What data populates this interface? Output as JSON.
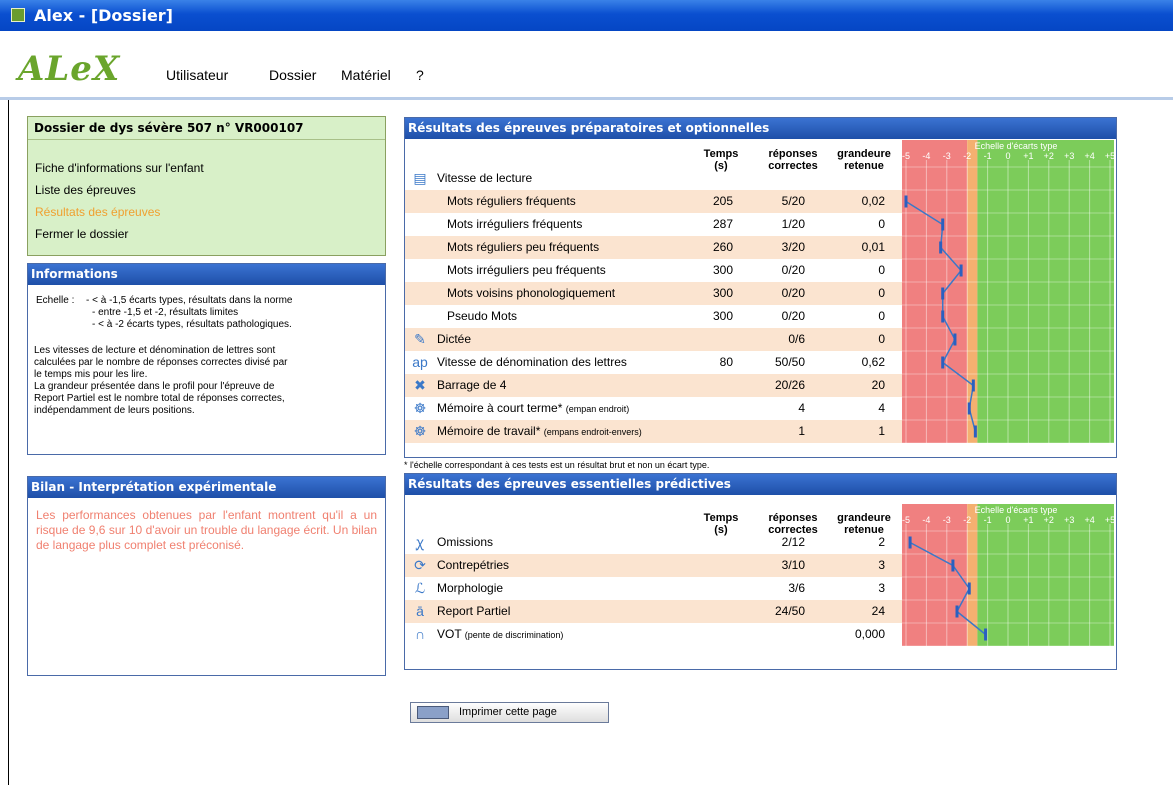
{
  "window": {
    "title": "Alex - [Dossier]"
  },
  "app": {
    "logo": "ALeX"
  },
  "menu": [
    "Utilisateur",
    "Dossier",
    "Matériel",
    "?"
  ],
  "dossier": {
    "title": "Dossier de dys sévère 507 n° VR000107",
    "links": [
      "Fiche d'informations sur l'enfant",
      "Liste des épreuves",
      "Résultats des épreuves",
      "Fermer le dossier"
    ],
    "active_index": 2
  },
  "info": {
    "title": "Informations",
    "scale_label": "Echelle :",
    "scale_lines": [
      "- < à -1,5 écarts types, résultats dans la norme",
      "- entre -1,5 et -2,  résultats limites",
      "- < à -2 écarts types, résultats pathologiques."
    ],
    "text_lines": [
      "Les vitesses de lecture et dénomination de lettres sont",
      "calculées par le nombre de réponses correctes divisé par",
      "le temps mis pour les lire.",
      "La grandeur présentée dans le profil pour l'épreuve de",
      "Report Partiel est le nombre total de réponses correctes,",
      "indépendamment de leurs positions."
    ]
  },
  "bilan": {
    "title": "Bilan - Interprétation expérimentale",
    "text": "Les performances obtenues par l'enfant montrent qu'il a un risque de 9,6 sur 10 d'avoir un trouble du langage écrit. Un bilan de langage plus complet est préconisé."
  },
  "columns": {
    "temps": [
      "Temps",
      "(s)"
    ],
    "reponses": [
      "réponses",
      "correctes"
    ],
    "grandeure": [
      "grandeure",
      "retenue"
    ],
    "scale_title": "Echelle d'écarts type",
    "scale_ticks": [
      "-5",
      "-4",
      "-3",
      "-2",
      "-1",
      "0",
      "+1",
      "+2",
      "+3",
      "+4",
      "+5"
    ]
  },
  "results1": {
    "title": "Résultats des épreuves préparatoires  et optionnelles",
    "rows": [
      {
        "label": "Vitesse de lecture",
        "icon": "book-icon",
        "header": true
      },
      {
        "label": "Mots réguliers fréquents",
        "temps": "205",
        "reponses": "5/20",
        "grandeur": "0,02",
        "indent": true
      },
      {
        "label": "Mots irréguliers fréquents",
        "temps": "287",
        "reponses": "1/20",
        "grandeur": "0",
        "indent": true
      },
      {
        "label": "Mots réguliers peu fréquents",
        "temps": "260",
        "reponses": "3/20",
        "grandeur": "0,01",
        "indent": true
      },
      {
        "label": "Mots irréguliers peu fréquents",
        "temps": "300",
        "reponses": "0/20",
        "grandeur": "0",
        "indent": true
      },
      {
        "label": "Mots voisins phonologiquement",
        "temps": "300",
        "reponses": "0/20",
        "grandeur": "0",
        "indent": true
      },
      {
        "label": "Pseudo Mots",
        "temps": "300",
        "reponses": "0/20",
        "grandeur": "0",
        "indent": true
      },
      {
        "label": "Dictée",
        "icon": "pen-icon",
        "temps": "",
        "reponses": "0/6",
        "grandeur": "0"
      },
      {
        "label": "Vitesse de dénomination des lettres",
        "icon": "letters-icon",
        "temps": "80",
        "reponses": "50/50",
        "grandeur": "0,62"
      },
      {
        "label": "Barrage de 4",
        "icon": "cross-icon",
        "temps": "",
        "reponses": "20/26",
        "grandeur": "20"
      },
      {
        "label": "Mémoire à court terme*",
        "note": "(empan endroit)",
        "icon": "memory-icon",
        "temps": "",
        "reponses": "4",
        "grandeur": "4"
      },
      {
        "label": "Mémoire de travail*",
        "note": "(empans endroit-envers)",
        "icon": "memory-icon",
        "temps": "",
        "reponses": "1",
        "grandeur": "1"
      }
    ],
    "scores": [
      -5,
      -3.2,
      -3.3,
      -2.3,
      -3.2,
      -3.2,
      -2.6,
      -3.2,
      -1.7,
      -1.9,
      -1.6
    ],
    "footnote": "* l'échelle correspondant à ces tests est un résultat brut et non un écart type."
  },
  "results2": {
    "title": "Résultats des épreuves essentielles prédictives",
    "rows": [
      {
        "label": "Omissions",
        "icon": "omission-icon",
        "temps": "",
        "reponses": "2/12",
        "grandeur": "2"
      },
      {
        "label": "Contrepétries",
        "icon": "refresh-icon",
        "temps": "",
        "reponses": "3/10",
        "grandeur": "3"
      },
      {
        "label": "Morphologie",
        "icon": "morpho-icon",
        "temps": "",
        "reponses": "3/6",
        "grandeur": "3"
      },
      {
        "label": "Report Partiel",
        "icon": "report-icon",
        "temps": "",
        "reponses": "24/50",
        "grandeur": "24"
      },
      {
        "label": "VOT",
        "note": "(pente de discrimination)",
        "icon": "headphones-icon",
        "temps": "",
        "reponses": "",
        "grandeur": "0,000"
      }
    ],
    "scores": [
      -4.8,
      -2.7,
      -1.9,
      -2.5,
      -1.1
    ]
  },
  "print": {
    "label": "Imprimer cette page"
  },
  "colors": {
    "red": "#f08080",
    "orange": "#f4b070",
    "green": "#7ccc5a",
    "line": "#3a78c8"
  }
}
